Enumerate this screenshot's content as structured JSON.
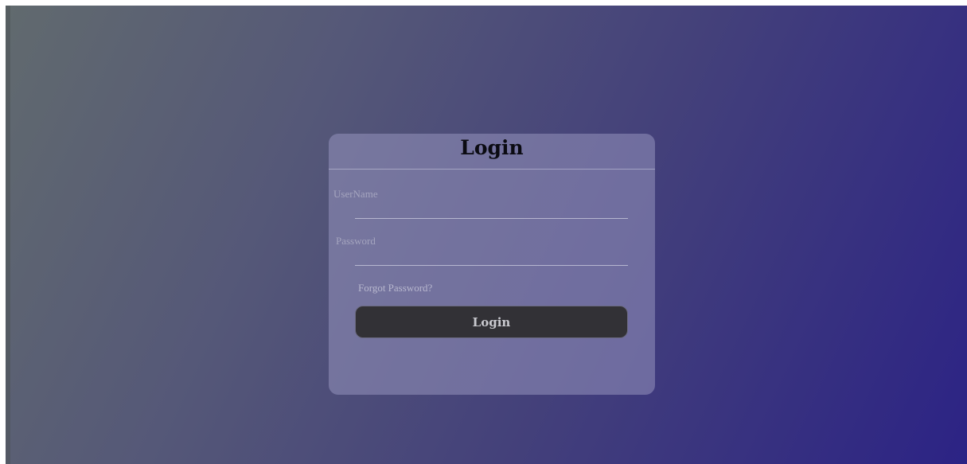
{
  "login_form": {
    "title": "Login",
    "username_label": "UserName",
    "username_value": "",
    "password_label": "Password",
    "password_value": "",
    "forgot_password_text": "Forgot Password?",
    "submit_label": "Login"
  },
  "colors": {
    "background_gradient_start": "#616a6e",
    "background_gradient_end": "#2c2385",
    "card_background": "#8c8ab4",
    "button_background": "#323136",
    "title_text": "#0b0b12"
  }
}
